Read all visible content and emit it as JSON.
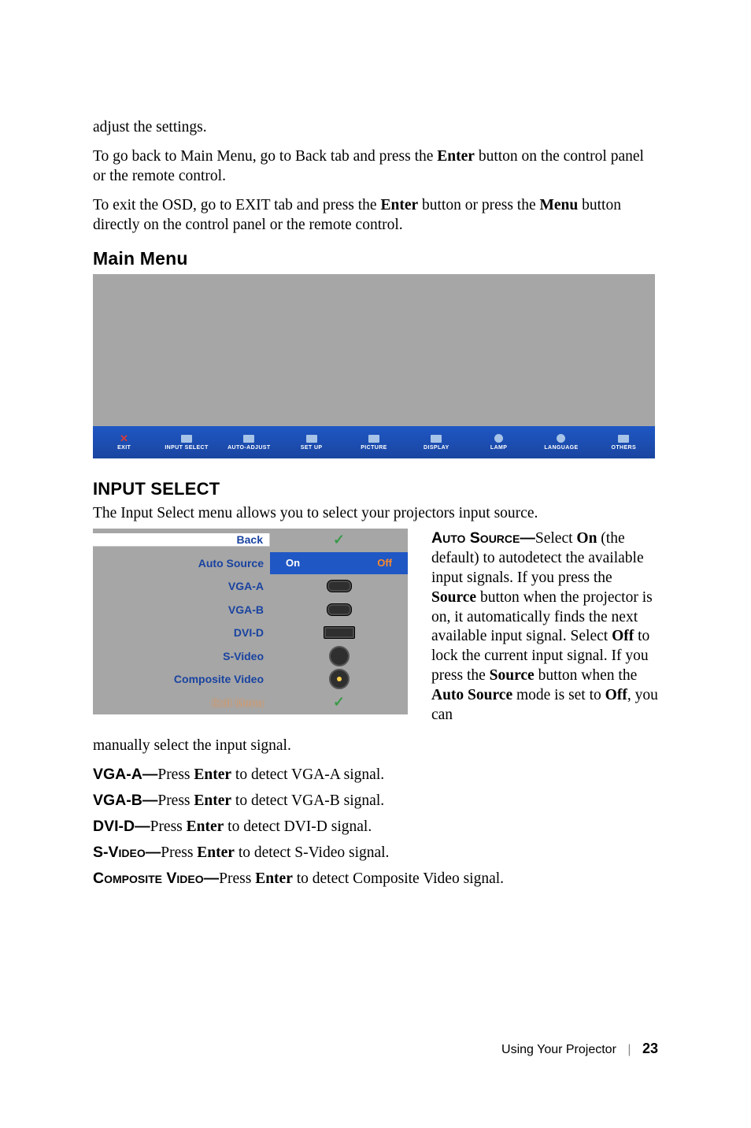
{
  "intro": {
    "p1": "adjust the settings.",
    "p2a": "To go back to Main Menu, go to Back tab and press the ",
    "p2b": "Enter",
    "p2c": " button on the control panel or the remote control.",
    "p3a": "To exit the OSD, go to EXIT tab and press the ",
    "p3b": "Enter",
    "p3c": " button or press the ",
    "p3d": "Menu",
    "p3e": " button directly on the control panel or the remote control."
  },
  "headings": {
    "main_menu": "Main Menu",
    "input_select": "INPUT SELECT"
  },
  "mainmenu_tabs": [
    {
      "label": "EXIT",
      "icon": "x"
    },
    {
      "label": "INPUT SELECT",
      "icon": "box"
    },
    {
      "label": "AUTO-ADJUST",
      "icon": "box"
    },
    {
      "label": "SET UP",
      "icon": "box"
    },
    {
      "label": "PICTURE",
      "icon": "box"
    },
    {
      "label": "DISPLAY",
      "icon": "box"
    },
    {
      "label": "LAMP",
      "icon": "circ"
    },
    {
      "label": "LANGUAGE",
      "icon": "circ"
    },
    {
      "label": "OTHERS",
      "icon": "box"
    }
  ],
  "input_select_intro": "The Input Select menu allows you to select your projectors input source.",
  "input_select_menu": {
    "back": "Back",
    "auto_source": "Auto Source",
    "on": "On",
    "off": "Off",
    "vga_a": "VGA-A",
    "vga_b": "VGA-B",
    "dvi_d": "DVI-D",
    "s_video": "S-Video",
    "composite": "Composite Video",
    "exit": "Exit Menu"
  },
  "auto_source_desc": {
    "label": "Auto Source—",
    "t1": "Select ",
    "on": "On",
    "t2": " (the default) to autodetect the available input signals. If you press the ",
    "source1": "Source",
    "t3": " button when the projector is on, it automatically finds the next available input signal. Select ",
    "off": "Off",
    "t4": " to lock the current input signal. If you press the ",
    "source2": "Source",
    "t5": " button when the ",
    "as": "Auto Source",
    "t6": " mode is set to ",
    "off2": "Off",
    "t7": ", you can"
  },
  "continue_text": "manually select the input signal.",
  "items": {
    "vga_a": {
      "label": "VGA-A—",
      "pre": "Press ",
      "btn": "Enter",
      "post": " to detect VGA-A signal."
    },
    "vga_b": {
      "label": "VGA-B—",
      "pre": "Press ",
      "btn": "Enter",
      "post": " to detect VGA-B signal."
    },
    "dvi_d": {
      "label": "DVI-D—",
      "pre": "Press ",
      "btn": "Enter",
      "post": " to detect DVI-D signal."
    },
    "s_video": {
      "label": "S-Video—",
      "pre": "Press ",
      "btn": "Enter",
      "post": " to detect S-Video signal."
    },
    "composite": {
      "label": "Composite Video—",
      "pre": "Press ",
      "btn": "Enter",
      "post": " to detect Composite Video signal."
    }
  },
  "footer": {
    "section": "Using Your Projector",
    "page": "23"
  }
}
